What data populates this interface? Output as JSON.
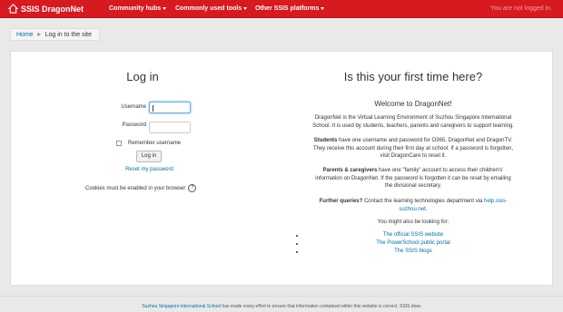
{
  "navbar": {
    "brand": "SSIS DragonNet",
    "menus": [
      {
        "label": "Community hubs"
      },
      {
        "label": "Commonly used tools"
      },
      {
        "label": "Other SSIS platforms"
      }
    ],
    "status": "You are not logged in."
  },
  "breadcrumb": {
    "home": "Home",
    "current": "Log in to the site"
  },
  "login": {
    "title": "Log in",
    "username_label": "Username",
    "password_label": "Password",
    "remember_label": "Remember username",
    "login_button": "Log in",
    "reset_link": "Reset my password",
    "cookies_note": "Cookies must be enabled in your browser"
  },
  "info": {
    "title": "Is this your first time here?",
    "welcome": "Welcome to DragonNet!",
    "intro_1": "DragonNet is the Virtual Learning Environment of Suzhou Singapore International",
    "intro_2": "School. It is used by students, teachers, parents and caregivers to support learning.",
    "students_bold": "Students",
    "students_1": " have one username and password for O365, DragonNet and DragonTV.",
    "students_2": "They receive this account during their first day at school. If a password is forgotten,",
    "students_3": "visit DragonCare to reset it.",
    "parents_bold": "Parents & caregivers",
    "parents_1": " have one \"family\" account to access their children's'",
    "parents_2": "information on DragonNet. If the password is forgotten it can be reset by emailing",
    "parents_3": "the divisional secretary.",
    "queries_bold": "Further queries?",
    "queries_1": " Contact the learning technologies department via ",
    "queries_link_1": "help.ssis-",
    "queries_link_2": "suzhou.net",
    "queries_end": ".",
    "also": "You might also be looking for:",
    "links": [
      "The official SSIS website",
      "The PowerSchool public portal",
      "The SSIS blogs"
    ]
  },
  "footer": {
    "school_link": "Suzhou Singapore International School",
    "text": " has made every effort to ensure that information contained within this website is correct. SSIS does"
  }
}
